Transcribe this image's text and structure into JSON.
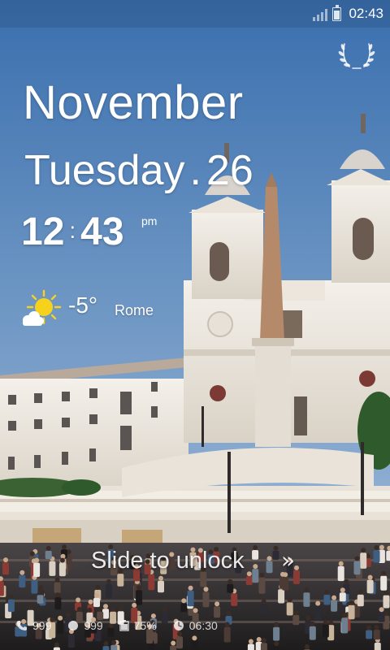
{
  "status_bar": {
    "time": "02:43",
    "signal_icon": "signal-bars-icon",
    "battery_icon": "battery-icon"
  },
  "badge_icon": "laurel-wreath-icon",
  "clock": {
    "month": "November",
    "weekday": "Tuesday",
    "separator": ".",
    "day": "26",
    "hour": "12",
    "colon": ":",
    "minute": "43",
    "ampm": "pm"
  },
  "weather": {
    "icon": "sun-cloud-icon",
    "temperature": "-5°",
    "city": "Rome"
  },
  "unlock": {
    "label": "Slide to unlock",
    "icon": "double-chevron-right-icon"
  },
  "notifications": {
    "missed_calls": "999",
    "unread_messages": "999",
    "battery": "75%",
    "alarm": "06:30"
  },
  "colors": {
    "sky_top": "#3a6fae",
    "sky_mid": "#6c95c3",
    "building": "#f1ede6",
    "crowd": "#2d2b2c"
  }
}
